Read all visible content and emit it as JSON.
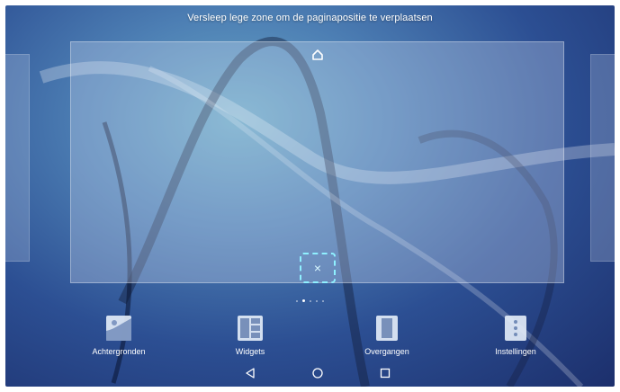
{
  "hint_text": "Versleep lege zone om de paginapositie te verplaatsen",
  "page_indicator": {
    "count": 5,
    "active_index": 1
  },
  "preview": {
    "home_icon": "home-icon",
    "delete_icon": "close-icon",
    "delete_symbol": "×"
  },
  "actions": [
    {
      "label": "Achtergronden",
      "icon": "wallpaper-icon"
    },
    {
      "label": "Widgets",
      "icon": "widgets-icon"
    },
    {
      "label": "Overgangen",
      "icon": "transitions-icon"
    },
    {
      "label": "Instellingen",
      "icon": "settings-icon"
    }
  ],
  "navigation": {
    "back_icon": "back-icon",
    "home_icon": "home-circle-icon",
    "recent_icon": "recent-apps-icon"
  },
  "colors": {
    "accent_dashed": "#8ff0ff",
    "text": "#ffffff"
  }
}
